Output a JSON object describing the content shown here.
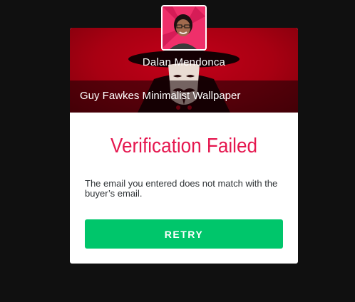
{
  "seller": {
    "name": "Dalan Mendonca"
  },
  "product": {
    "title": "Guy Fawkes Minimalist Wallpaper"
  },
  "dialog": {
    "heading": "Verification Failed",
    "message": "The email you entered does not match with the buyer’s email.",
    "retry_label": "RETRY"
  },
  "colors": {
    "page_background": "#101010",
    "banner_red": "#a80012",
    "heading_red": "#e5174f",
    "button_green": "#00c66b"
  },
  "icons": {
    "banner_image": "guy-fawkes-mask-image",
    "avatar": "seller-avatar-photo"
  }
}
